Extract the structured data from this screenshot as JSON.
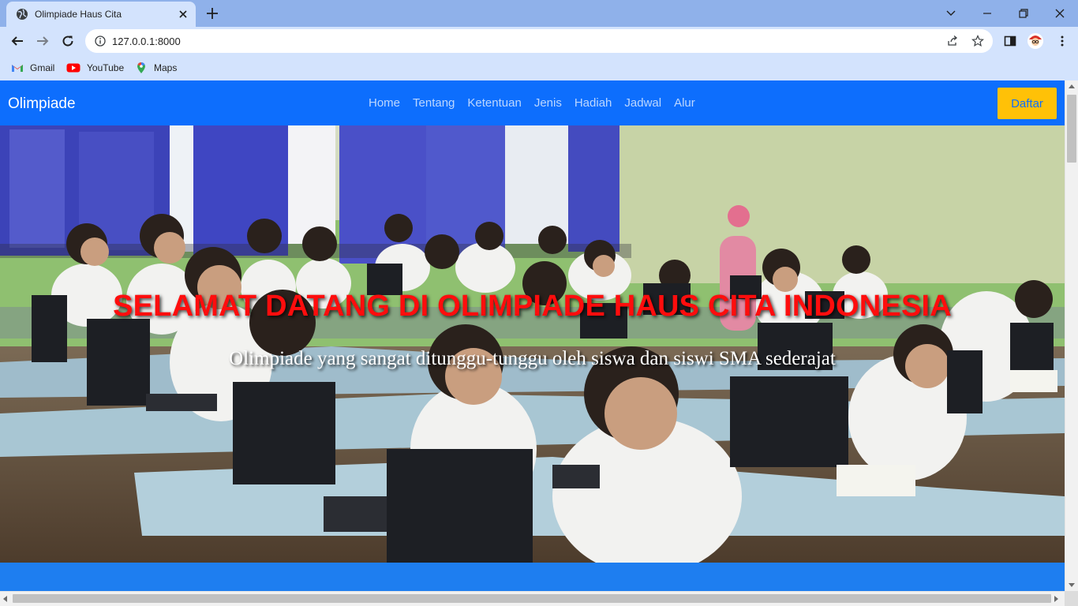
{
  "browser": {
    "tab_title": "Olimpiade Haus Cita",
    "url": "127.0.0.1:8000",
    "bookmarks": [
      {
        "label": "Gmail",
        "icon": "gmail-icon"
      },
      {
        "label": "YouTube",
        "icon": "youtube-icon"
      },
      {
        "label": "Maps",
        "icon": "maps-icon"
      }
    ]
  },
  "site": {
    "brand": "Olimpiade",
    "nav": [
      "Home",
      "Tentang",
      "Ketentuan",
      "Jenis",
      "Hadiah",
      "Jadwal",
      "Alur"
    ],
    "cta": "Daftar",
    "hero": {
      "title": "SELAMAT DATANG DI OLIMPIADE HAUS CITA INDONESIA",
      "subtitle": "Olimpiade yang sangat ditunggu-tunggu oleh siswa dan siswi SMA sederajat",
      "image": "classroom-students-computers-photo"
    }
  },
  "colors": {
    "navbar": "#0d6efd",
    "cta_bg": "#ffc107",
    "hero_title": "#ff0d0d",
    "band": "#1e7ef0",
    "chrome_tabstrip": "#8fb1ea",
    "chrome_toolbar": "#d3e3fd"
  }
}
